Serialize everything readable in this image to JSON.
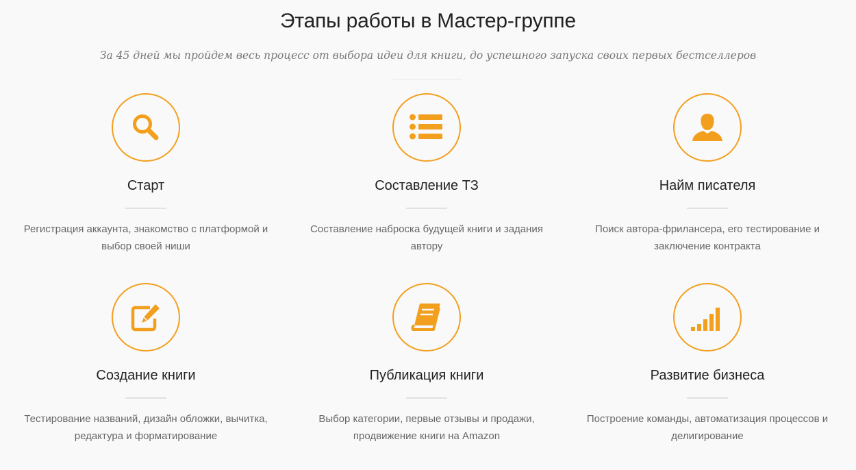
{
  "header": {
    "title": "Этапы работы в Мастер-группе",
    "subtitle": "За 45 дней мы пройдем весь процесс от выбора идеи для книги, до успешного запуска своих первых бестселлеров"
  },
  "accent_color": "#f29f1d",
  "steps": [
    {
      "icon": "search-icon",
      "title": "Старт",
      "description": "Регистрация аккаунта, знакомство с платформой и выбор своей ниши"
    },
    {
      "icon": "list-icon",
      "title": "Составление ТЗ",
      "description": "Составление наброска будущей книги и задания автору"
    },
    {
      "icon": "user-icon",
      "title": "Найм писателя",
      "description": "Поиск автора-фриланcера, его тестирование и заключение контракта"
    },
    {
      "icon": "edit-icon",
      "title": "Создание книги",
      "description": "Тестирование названий, дизайн обложки, вычитка, редактура и форматирование"
    },
    {
      "icon": "book-icon",
      "title": "Публикация книги",
      "description": "Выбор категории, первые отзывы и продажи, продвижение книги на Amazon"
    },
    {
      "icon": "signal-icon",
      "title": "Развитие бизнеса",
      "description": "Построение команды, автоматизация процессов и делигирование"
    }
  ]
}
